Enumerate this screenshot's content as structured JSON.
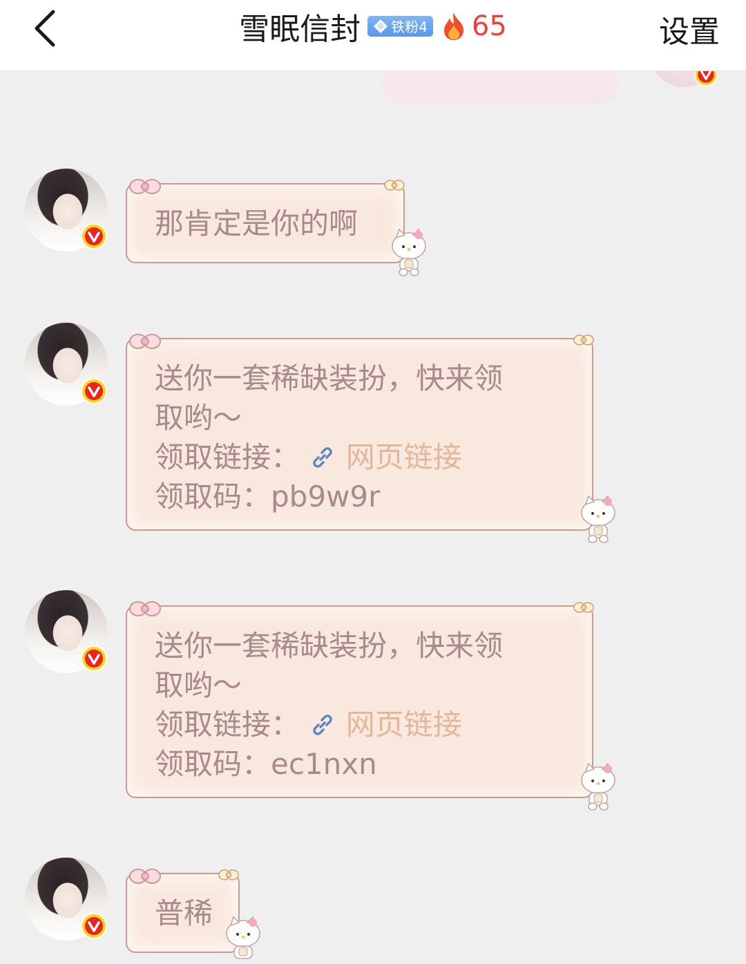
{
  "header": {
    "title": "雪眠信封",
    "fan_badge": "铁粉4",
    "fire_count": "65",
    "settings_label": "设置"
  },
  "messages": [
    {
      "lines": [
        "那肯定是你的啊"
      ]
    },
    {
      "lines": [
        "送你一套稀缺装扮，快来领",
        "取哟～"
      ],
      "link_label": "领取链接：",
      "link_text": "网页链接",
      "code_label": "领取码：",
      "code": "pb9w9r"
    },
    {
      "lines": [
        "送你一套稀缺装扮，快来领",
        "取哟～"
      ],
      "link_label": "领取链接：",
      "link_text": "网页链接",
      "code_label": "领取码：",
      "code": "ec1nxn"
    },
    {
      "lines": [
        "普稀"
      ]
    }
  ],
  "colors": {
    "bubble_bg": "#f9e8dd",
    "bubble_border": "#c99a8e",
    "message_text": "#a8898c",
    "link_text": "#e2b79c",
    "fire_count": "#ef4036",
    "badge_blue": "#6aa5f0"
  },
  "icons": {
    "back": "chevron-left-icon",
    "fire": "fire-icon",
    "diamond": "diamond-icon",
    "verified": "verified-v-icon",
    "link": "link-icon"
  }
}
